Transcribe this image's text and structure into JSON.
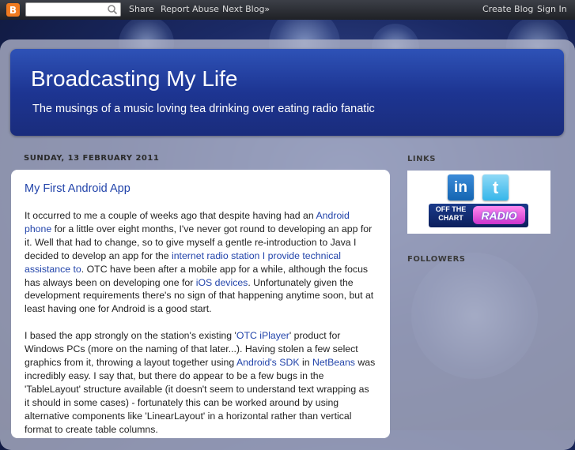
{
  "navbar": {
    "logo": "B",
    "search_value": "",
    "links": [
      "Share",
      "Report Abuse",
      "Next Blog»"
    ],
    "right_links": [
      "Create Blog",
      "Sign In"
    ]
  },
  "header": {
    "title": "Broadcasting My Life",
    "description": "The musings of a music loving tea drinking over eating radio fanatic"
  },
  "post": {
    "date": "SUNDAY, 13 FEBRUARY 2011",
    "title": "My First Android App",
    "p1": {
      "t1": "It occurred to me a couple of weeks ago that despite having had an ",
      "l1": "Android phone",
      "t2": " for a little over eight months, I've never got round to developing an app for it. Well that had to change, so to give myself a gentle re-introduction to Java I decided to develop an app for the ",
      "l2": "internet radio station I provide technical assistance to",
      "t3": ". OTC have been after a mobile app for a while, although the focus has always been on developing one for ",
      "l3": "iOS devices",
      "t4": ". Unfortunately given the development requirements there's no sign of that happening anytime soon, but at least having one for Android is a good start."
    },
    "p2": {
      "t1": "I based the app strongly on the station's existing '",
      "l1": "OTC iPlayer",
      "t2": "' product for Windows PCs (more on the naming of that later...). Having stolen a few select graphics from it, throwing a layout together using ",
      "l2": "Android's SDK",
      "t3": " in ",
      "l3": "NetBeans",
      "t4": " was incredibly easy. I say that, but there do appear to be a few bugs in the 'TableLayout' structure available (it doesn't seem to understand text wrapping as it should in some cases) - fortunately this can be worked around by using alternative components like 'LinearLayout' in a horizontal rather than vertical format to create table columns."
    }
  },
  "sidebar": {
    "links_heading": "LINKS",
    "followers_heading": "FOLLOWERS",
    "linkedin_text": "in",
    "twitter_text": "t",
    "otc_left_lines": [
      "OFF THE",
      "CHART"
    ],
    "otc_right": "RADIO"
  },
  "colors": {
    "link": "#2244aa",
    "header_blue": "#1d3592",
    "blogger_orange": "#f07b20"
  }
}
